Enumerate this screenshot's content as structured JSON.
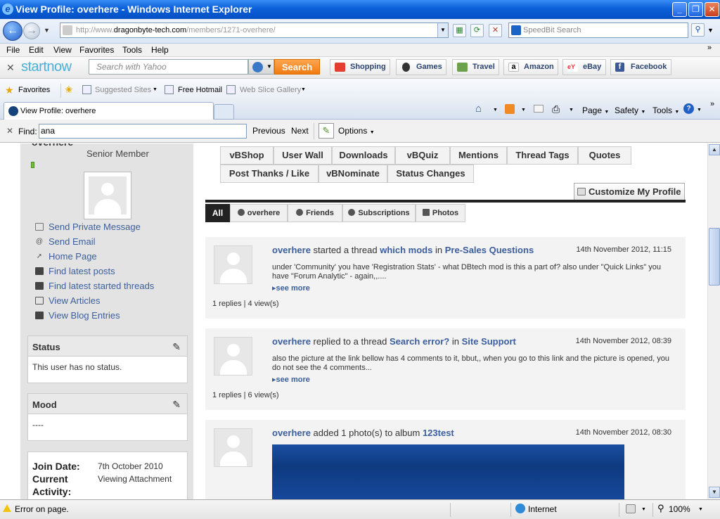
{
  "window": {
    "title": "View Profile: overhere - Windows Internet Explorer"
  },
  "address_bar": {
    "url_prefix": "http://www.",
    "url_host": "dragonbyte-tech.com",
    "url_path": "/members/1271-overhere/",
    "search_placeholder": "SpeedBit Search"
  },
  "menu": [
    "File",
    "Edit",
    "View",
    "Favorites",
    "Tools",
    "Help"
  ],
  "startnow": {
    "logo": "startnow",
    "search_placeholder": "Search with Yahoo",
    "search_button": "Search",
    "links": [
      "Shopping",
      "Games",
      "Travel",
      "Amazon",
      "eBay",
      "Facebook"
    ]
  },
  "favorites": {
    "label": "Favorites",
    "items": [
      "Suggested Sites",
      "Free Hotmail",
      "Web Slice Gallery"
    ]
  },
  "tab": {
    "title": "View Profile: overhere"
  },
  "commands": [
    "Page",
    "Safety",
    "Tools"
  ],
  "find": {
    "label": "Find:",
    "value": "ana",
    "previous": "Previous",
    "next": "Next",
    "options": "Options"
  },
  "profile": {
    "username": "overhere",
    "rank": "Senior Member",
    "links": [
      "Send Private Message",
      "Send Email",
      "Home Page",
      "Find latest posts",
      "Find latest started threads",
      "View Articles",
      "View Blog Entries"
    ],
    "status_title": "Status",
    "status_text": "This user has no status.",
    "mood_title": "Mood",
    "mood_text": "----",
    "join_label": "Join Date:",
    "join_value": "7th October 2010",
    "activity_label": "Current Activity:",
    "activity_label_1": "Current",
    "activity_label_2": "Activity:",
    "activity_value": "Viewing Attachment"
  },
  "profile_tabs": {
    "row1": [
      "vBShop",
      "User Wall",
      "Downloads",
      "vBQuiz",
      "Mentions",
      "Thread Tags",
      "Quotes"
    ],
    "row2": [
      "Post Thanks / Like",
      "vBNominate",
      "Status Changes"
    ],
    "customize": "Customize My Profile"
  },
  "activity_tabs": [
    "All",
    "overhere",
    "Friends",
    "Subscriptions",
    "Photos"
  ],
  "activities": [
    {
      "user": "overhere",
      "action": "started a thread",
      "target": "which mods",
      "in": "in",
      "forum": "Pre-Sales Questions",
      "date": "14th November 2012, 11:15",
      "excerpt": "under 'Community' you have 'Registration Stats' - what DBtech mod is this a part of? also under \"Quick Links\" you have \"Forum Analytic\" - again,,....",
      "more": "see more",
      "stats": "1 replies | 4 view(s)"
    },
    {
      "user": "overhere",
      "action": "replied to a thread",
      "target": "Search error?",
      "in": "in",
      "forum": "Site Support",
      "date": "14th November 2012, 08:39",
      "excerpt": "also the picture at the link bellow has 4 comments to it, bbut,, when you go to this link and the picture is opened, you do not see the 4 comments...",
      "more": "see more",
      "stats": "1 replies | 6 view(s)"
    },
    {
      "user": "overhere",
      "action": "added 1 photo(s) to album",
      "target": "123test",
      "date": "14th November 2012, 08:30"
    }
  ],
  "statusbar": {
    "message": "Error on page.",
    "zone": "Internet",
    "zoom": "100%"
  }
}
